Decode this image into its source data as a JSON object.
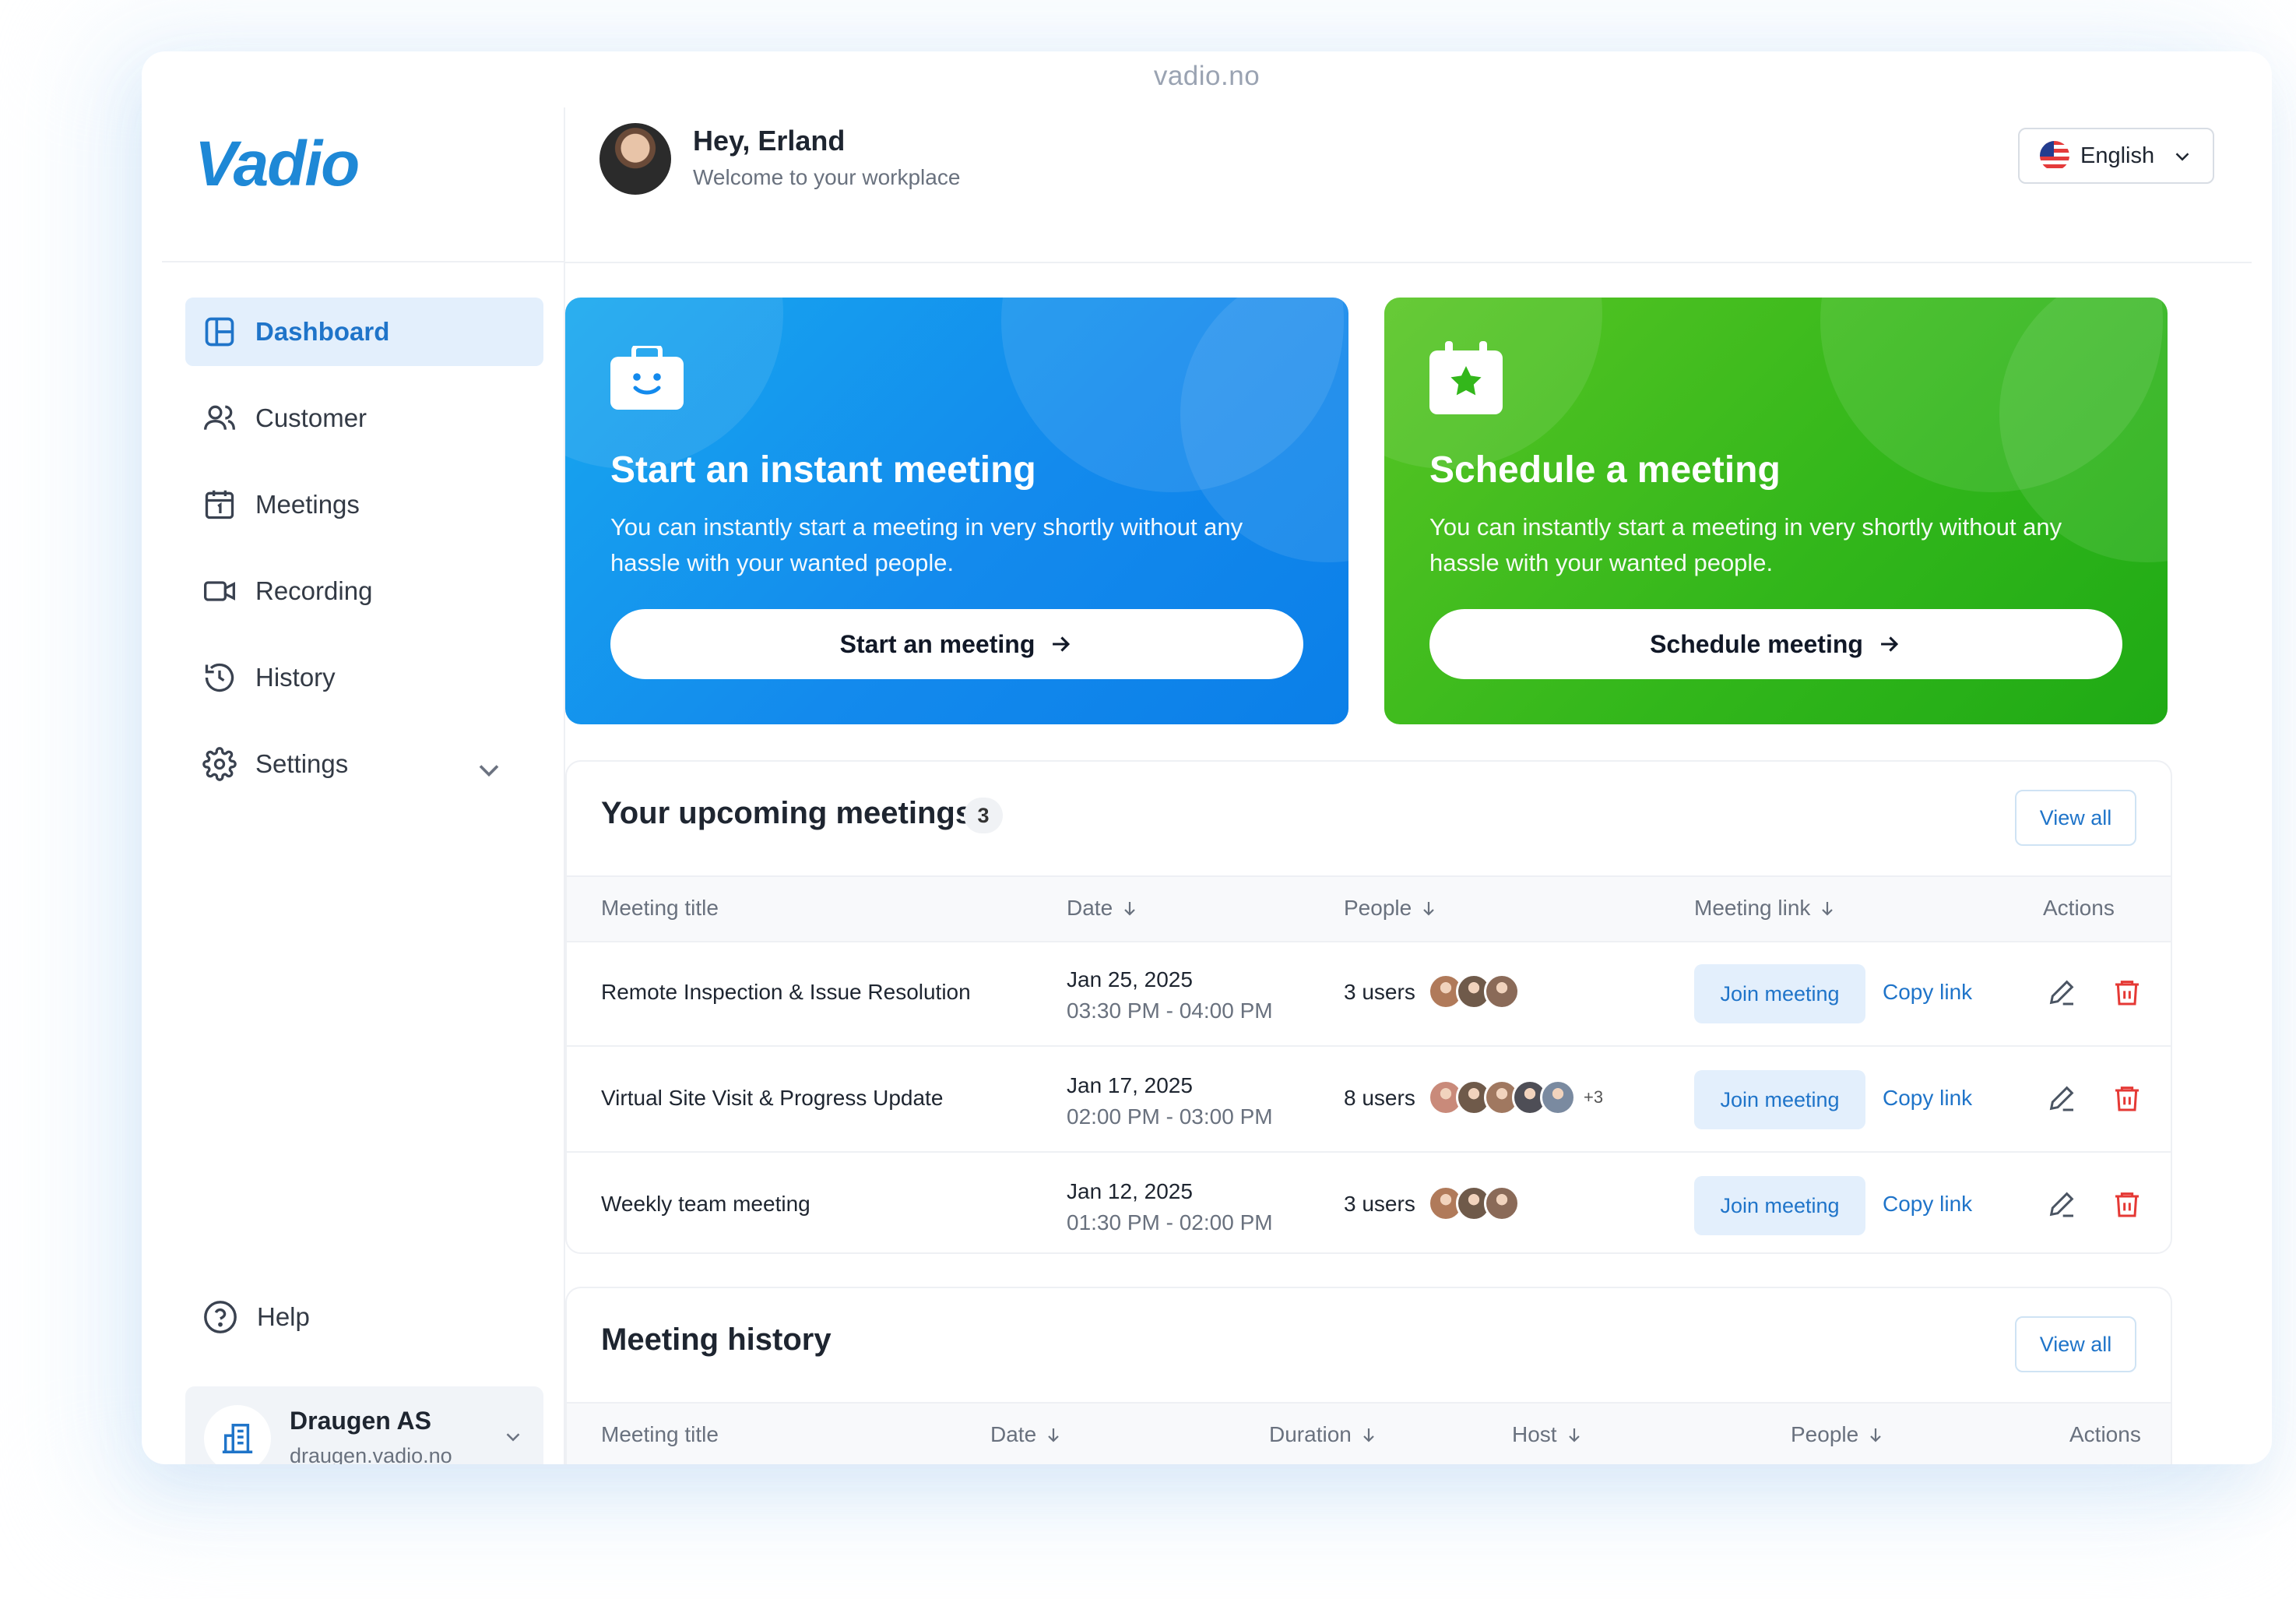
{
  "browser": {
    "url": "vadio.no"
  },
  "brand": {
    "logo_text": "Vadio",
    "accent": "#1e88d6"
  },
  "sidebar": {
    "items": [
      {
        "label": "Dashboard",
        "icon": "layout-icon",
        "active": true
      },
      {
        "label": "Customer",
        "icon": "users-icon"
      },
      {
        "label": "Meetings",
        "icon": "calendar-icon"
      },
      {
        "label": "Recording",
        "icon": "video-icon"
      },
      {
        "label": "History",
        "icon": "history-icon"
      },
      {
        "label": "Settings",
        "icon": "gear-icon",
        "expandable": true
      }
    ],
    "help_label": "Help",
    "org": {
      "name": "Draugen AS",
      "domain": "draugen.vadio.no"
    }
  },
  "header": {
    "greeting": "Hey, Erland",
    "subtitle": "Welcome to your workplace",
    "language": "English"
  },
  "cards": {
    "instant": {
      "title": "Start an instant meeting",
      "description": "You can instantly start a meeting in very shortly without any hassle with your wanted people.",
      "button": "Start an meeting",
      "color": "#138aed"
    },
    "schedule": {
      "title": "Schedule a meeting",
      "description": "You can instantly start a meeting in very shortly without any hassle with your wanted people.",
      "button": "Schedule meeting",
      "color": "#33b71b"
    }
  },
  "upcoming": {
    "title": "Your upcoming meetings",
    "count": "3",
    "view_all": "View all",
    "columns": [
      "Meeting title",
      "Date",
      "People",
      "Meeting link",
      "Actions"
    ],
    "rows": [
      {
        "title": "Remote Inspection & Issue Resolution",
        "date": "Jan 25, 2025",
        "time": "03:30 PM - 04:00 PM",
        "users": "3 users",
        "avatars": [
          "#b07a5a",
          "#6f5a4a",
          "#8a6a58"
        ],
        "more": "",
        "join": "Join meeting",
        "copy": "Copy link"
      },
      {
        "title": "Virtual Site Visit & Progress Update",
        "date": "Jan 17, 2025",
        "time": "02:00 PM - 03:00 PM",
        "users": "8 users",
        "avatars": [
          "#c98a7a",
          "#6f5a4a",
          "#a07860",
          "#4e4e56",
          "#7a8aa0"
        ],
        "more": "+3",
        "join": "Join meeting",
        "copy": "Copy link"
      },
      {
        "title": "Weekly team meeting",
        "date": "Jan 12, 2025",
        "time": "01:30 PM - 02:00 PM",
        "users": "3 users",
        "avatars": [
          "#b07a5a",
          "#6f5a4a",
          "#8a6a58"
        ],
        "more": "",
        "join": "Join meeting",
        "copy": "Copy link"
      }
    ]
  },
  "history": {
    "title": "Meeting history",
    "view_all": "View all",
    "columns": [
      "Meeting title",
      "Date",
      "Duration",
      "Host",
      "People",
      "Actions"
    ]
  },
  "colors": {
    "danger": "#e53935",
    "link": "#1f74c9"
  }
}
